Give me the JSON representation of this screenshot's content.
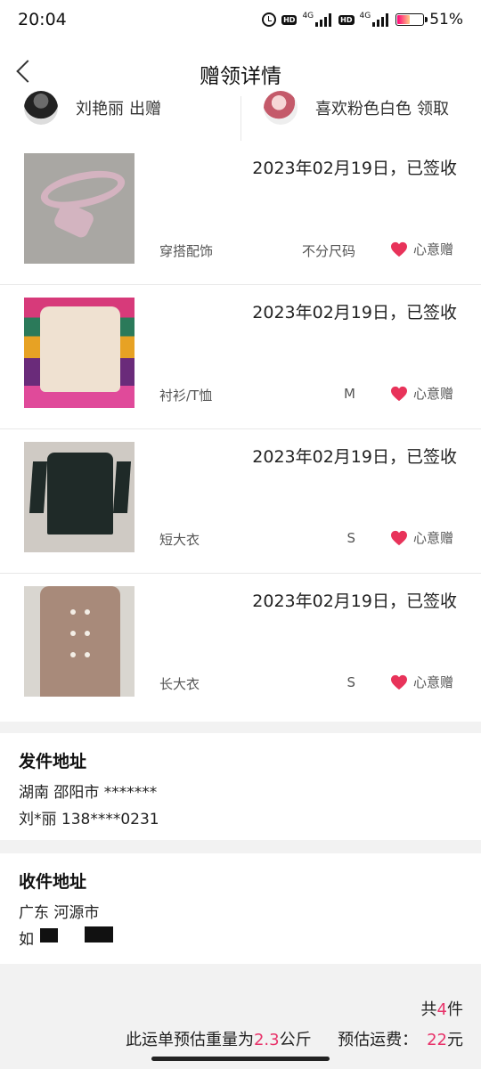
{
  "status_bar": {
    "time": "20:04",
    "hd": "HD",
    "network": "4G",
    "battery_percent": "51%",
    "battery_level": 0.51
  },
  "nav": {
    "title": "赠领详情"
  },
  "parties": {
    "giver": {
      "name": "刘艳丽",
      "role": "出赠"
    },
    "receiver": {
      "name": "喜欢粉色白色",
      "role": "领取"
    }
  },
  "items": [
    {
      "status": "2023年02月19日，已签收",
      "category": "穿搭配饰",
      "size": "不分尺码",
      "tag": "心意赠"
    },
    {
      "status": "2023年02月19日，已签收",
      "category": "衬衫/T恤",
      "size": "M",
      "tag": "心意赠"
    },
    {
      "status": "2023年02月19日，已签收",
      "category": "短大衣",
      "size": "S",
      "tag": "心意赠"
    },
    {
      "status": "2023年02月19日，已签收",
      "category": "长大衣",
      "size": "S",
      "tag": "心意赠"
    }
  ],
  "sender_address": {
    "title": "发件地址",
    "line1": "湖南 邵阳市 *******",
    "line2": "刘*丽 138****0231"
  },
  "receiver_address": {
    "title": "收件地址",
    "line1": "广东 河源市",
    "line2": "如"
  },
  "summary": {
    "count_prefix": "共",
    "count": "4",
    "count_suffix": "件",
    "weight_prefix": "此运单预估重量为",
    "weight": "2.3",
    "weight_unit": "公斤",
    "fee_label": "预估运费：",
    "fee": "22",
    "fee_unit": "元"
  },
  "colors": {
    "accent": "#e8336a",
    "heart": "#e8335a"
  }
}
